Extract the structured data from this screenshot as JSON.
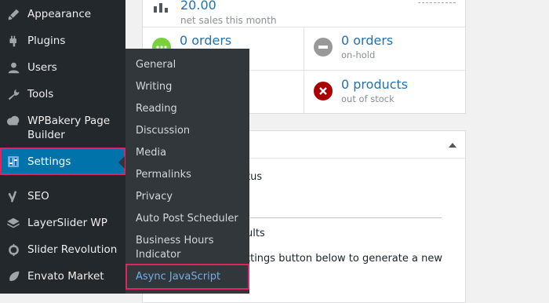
{
  "sidebar": {
    "items": [
      {
        "label": "Appearance",
        "icon": "paintbrush-icon"
      },
      {
        "label": "Plugins",
        "icon": "plugin-icon"
      },
      {
        "label": "Users",
        "icon": "user-icon"
      },
      {
        "label": "Tools",
        "icon": "wrench-icon"
      },
      {
        "label": "WPBakery Page Builder",
        "icon": "cloud-icon"
      },
      {
        "label": "Settings",
        "icon": "settings-icon"
      },
      {
        "label": "SEO",
        "icon": "yoast-icon"
      },
      {
        "label": "LayerSlider WP",
        "icon": "layers-icon"
      },
      {
        "label": "Slider Revolution",
        "icon": "refresh-icon"
      },
      {
        "label": "Envato Market",
        "icon": "leaf-icon"
      }
    ],
    "wpbakery_line1": "WPBakery Page",
    "wpbakery_line2": "Builder"
  },
  "submenu": {
    "items": [
      "General",
      "Writing",
      "Reading",
      "Discussion",
      "Media",
      "Permalinks",
      "Privacy",
      "Auto Post Scheduler"
    ],
    "business_line1": "Business Hours",
    "business_line2": "Indicator",
    "async": "Async JavaScript"
  },
  "status": {
    "net_sales_value": "20.00",
    "net_sales_label": "net sales this month",
    "processing_value": "0 orders",
    "processing_label": "ing",
    "onhold_value": "0 orders",
    "onhold_label": "on-hold",
    "outofstock_value": "0 products",
    "outofstock_label": "out of stock"
  },
  "widget2": {
    "line1": "tus",
    "line2": "ults",
    "line3": "ttings button below to generate a new"
  },
  "colors": {
    "sidebar_bg": "#23282d",
    "submenu_bg": "#32373c",
    "highlight_border": "#e0245e",
    "link_blue": "#2271b1"
  }
}
